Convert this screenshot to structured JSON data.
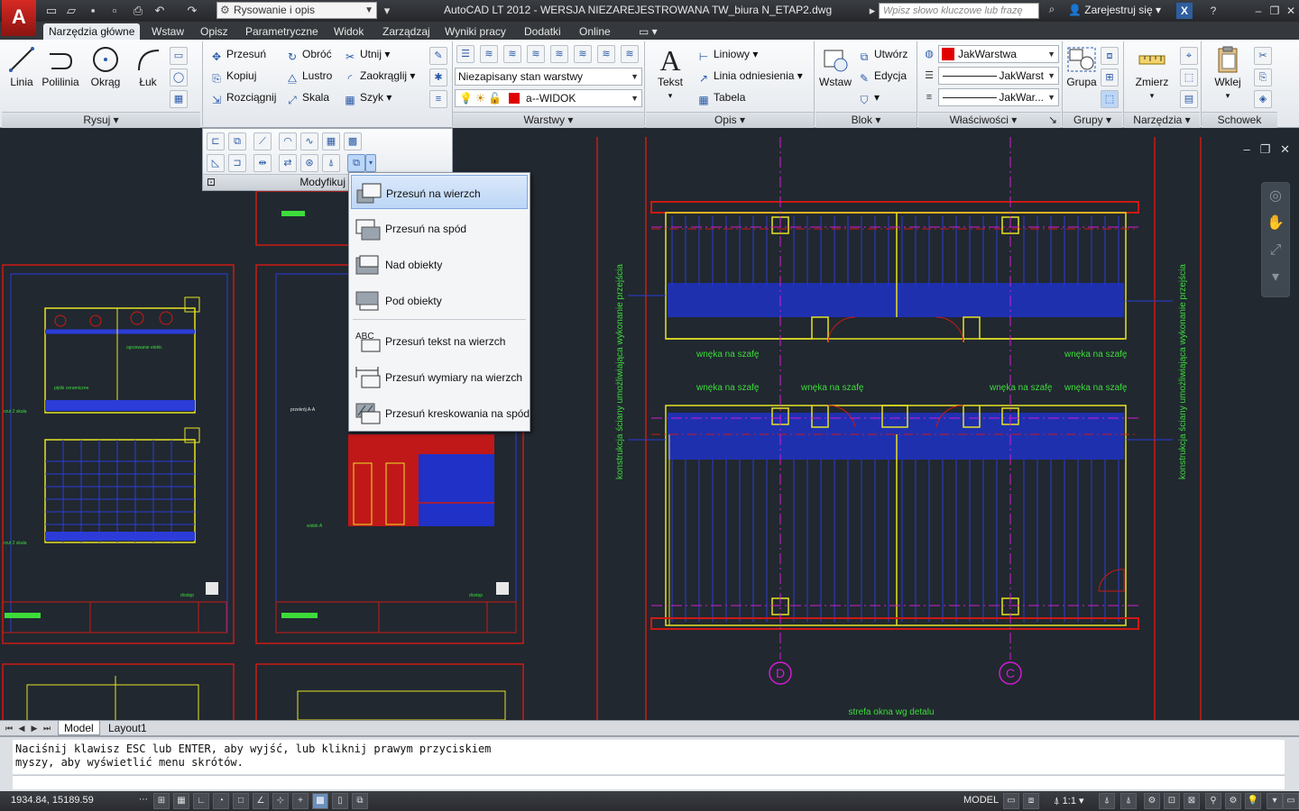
{
  "titlebar": {
    "workspace": "Rysowanie i opis",
    "title": "AutoCAD LT 2012 - WERSJA NIEZAREJESTROWANA    TW_biura N_ETAP2.dwg",
    "search_placeholder": "Wpisz słowo kluczowe lub frazę",
    "signin": "Zarejestruj się"
  },
  "tabs": [
    "Narzędzia główne",
    "Wstaw",
    "Opisz",
    "Parametryczne",
    "Widok",
    "Zarządzaj",
    "Wyniki pracy",
    "Dodatki",
    "Online"
  ],
  "ribbon": {
    "draw": {
      "line": "Linia",
      "polyline": "Polilinia",
      "circle": "Okrąg",
      "arc": "Łuk",
      "footer": "Rysuj"
    },
    "modify": {
      "move": "Przesuń",
      "rotate": "Obróć",
      "trim": "Utnij",
      "copy": "Kopiuj",
      "mirror": "Lustro",
      "fillet": "Zaokrąglij",
      "stretch": "Rozciągnij",
      "scale": "Skala",
      "array": "Szyk",
      "footer": "Modyfikuj"
    },
    "layers": {
      "state": "Niezapisany stan warstwy",
      "current": "a--WIDOK",
      "footer": "Warstwy"
    },
    "annotation": {
      "text": "Tekst",
      "linear": "Liniowy",
      "leader": "Linia odniesienia",
      "table": "Tabela",
      "footer": "Opis"
    },
    "block": {
      "insert": "Wstaw",
      "create": "Utwórz",
      "edit": "Edycja",
      "footer": "Blok"
    },
    "properties": {
      "color": "JakWarstwa",
      "linetype": "JakWarst",
      "lineweight": "JakWar...",
      "footer": "Właściwości"
    },
    "groups": {
      "group": "Grupa",
      "footer": "Grupy"
    },
    "utilities": {
      "measure": "Zmierz",
      "footer": "Narzędzia"
    },
    "clipboard": {
      "paste": "Wklej",
      "footer": "Schowek"
    }
  },
  "dropdown": {
    "items": [
      "Przesuń na wierzch",
      "Przesuń na spód",
      "Nad obiekty",
      "Pod obiekty",
      "Przesuń tekst na wierzch",
      "Przesuń wymiary na wierzch",
      "Przesuń kreskowania na spód"
    ]
  },
  "drawing": {
    "labels": {
      "wardrobe_niche": "wnęka na szafę",
      "window_zone": "strefa okna wg detalu",
      "wall_note": "konstrukcja ściany umożliwiająca wykonanie przejścia",
      "axis_d": "D",
      "axis_c": "C",
      "section": "przekrój A-A",
      "view": "widok A",
      "sheet_note": "dostęp"
    }
  },
  "layout_tabs": [
    "Model",
    "Layout1"
  ],
  "command": {
    "line1": "Naciśnij klawisz ESC lub ENTER, aby wyjść, lub kliknij prawym przyciskiem",
    "line2": "myszy, aby wyświetlić menu skrótów."
  },
  "status": {
    "coords": "1934.84, 15189.59",
    "model": "MODEL",
    "scale": "1:1"
  },
  "colors": {
    "accent_red": "#cc1a14",
    "menu_selected": "#bcd6f6",
    "cad_background": "#212830"
  }
}
